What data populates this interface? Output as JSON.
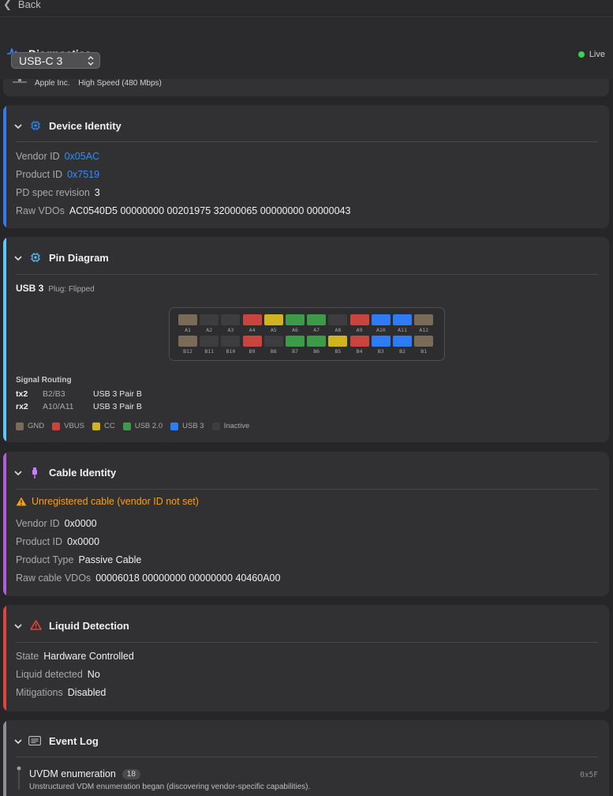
{
  "topbar": {
    "back_label": "Back"
  },
  "header": {
    "title": "Diagnostics",
    "live_label": "Live",
    "live_color": "#32d74b",
    "port_selector": "USB-C 3"
  },
  "partial_card": {
    "vendor": "Apple Inc.",
    "speed": "High Speed (480 Mbps)"
  },
  "device_identity": {
    "title": "Device Identity",
    "accent": "#2f7bf5",
    "rows": [
      {
        "key": "Vendor ID",
        "value": "0x05AC"
      },
      {
        "key": "Product ID",
        "value": "0x7519"
      },
      {
        "key": "PD spec revision",
        "value": "3"
      },
      {
        "key": "Raw VDOs",
        "value": "AC0540D5 00000000 00201975 32000065 00000000 00000043"
      }
    ]
  },
  "pin_diagram": {
    "title": "Pin Diagram",
    "accent": "#5ac8fa",
    "mode": "USB 3",
    "orientation": "Plug: Flipped",
    "row_a": [
      {
        "label": "A1",
        "type": "gnd"
      },
      {
        "label": "A2",
        "type": "inactive"
      },
      {
        "label": "A3",
        "type": "inactive"
      },
      {
        "label": "A4",
        "type": "vbus"
      },
      {
        "label": "A5",
        "type": "cc"
      },
      {
        "label": "A6",
        "type": "usb2"
      },
      {
        "label": "A7",
        "type": "usb2"
      },
      {
        "label": "A8",
        "type": "inactive"
      },
      {
        "label": "A9",
        "type": "vbus"
      },
      {
        "label": "A10",
        "type": "usb3"
      },
      {
        "label": "A11",
        "type": "usb3"
      },
      {
        "label": "A12",
        "type": "gnd"
      }
    ],
    "row_b": [
      {
        "label": "B12",
        "type": "gnd"
      },
      {
        "label": "B11",
        "type": "inactive"
      },
      {
        "label": "B10",
        "type": "inactive"
      },
      {
        "label": "B9",
        "type": "vbus"
      },
      {
        "label": "B8",
        "type": "inactive"
      },
      {
        "label": "B7",
        "type": "usb2"
      },
      {
        "label": "B6",
        "type": "usb2"
      },
      {
        "label": "B5",
        "type": "cc"
      },
      {
        "label": "B4",
        "type": "vbus"
      },
      {
        "label": "B3",
        "type": "usb3"
      },
      {
        "label": "B2",
        "type": "usb3"
      },
      {
        "label": "B1",
        "type": "gnd"
      }
    ],
    "routing_title": "Signal Routing",
    "routing": [
      {
        "signal": "tx2",
        "pins": "B2/B3",
        "desc": "USB 3 Pair B"
      },
      {
        "signal": "rx2",
        "pins": "A10/A11",
        "desc": "USB 3 Pair B"
      }
    ],
    "legend": [
      {
        "type": "gnd",
        "label": "GND",
        "color": "#7a6a58"
      },
      {
        "type": "vbus",
        "label": "VBUS",
        "color": "#c9443c"
      },
      {
        "type": "cc",
        "label": "CC",
        "color": "#d1b21f"
      },
      {
        "type": "usb2",
        "label": "USB 2.0",
        "color": "#3c9a48"
      },
      {
        "type": "usb3",
        "label": "USB 3",
        "color": "#2f7bf5"
      },
      {
        "type": "inactive",
        "label": "Inactive",
        "color": "#3d3d40"
      }
    ]
  },
  "cable_identity": {
    "title": "Cable Identity",
    "accent": "#b45be0",
    "warning": "Unregistered cable (vendor ID not set)",
    "warning_color": "#ff9f0a",
    "rows": [
      {
        "key": "Vendor ID",
        "value": "0x0000"
      },
      {
        "key": "Product ID",
        "value": "0x0000"
      },
      {
        "key": "Product Type",
        "value": "Passive Cable"
      },
      {
        "key": "Raw cable VDOs",
        "value": "00006018 00000000 00000000 40460A00"
      }
    ]
  },
  "liquid_detection": {
    "title": "Liquid Detection",
    "accent": "#e0443c",
    "rows": [
      {
        "key": "State",
        "value": "Hardware Controlled"
      },
      {
        "key": "Liquid detected",
        "value": "No"
      },
      {
        "key": "Mitigations",
        "value": "Disabled"
      }
    ]
  },
  "event_log": {
    "title": "Event Log",
    "accent": "#8e8e93",
    "events": [
      {
        "name": "UVDM enumeration",
        "count": "18",
        "code": "0x5F",
        "desc": "Unstructured VDM enumeration began (discovering vendor-specific capabilities)."
      }
    ]
  }
}
